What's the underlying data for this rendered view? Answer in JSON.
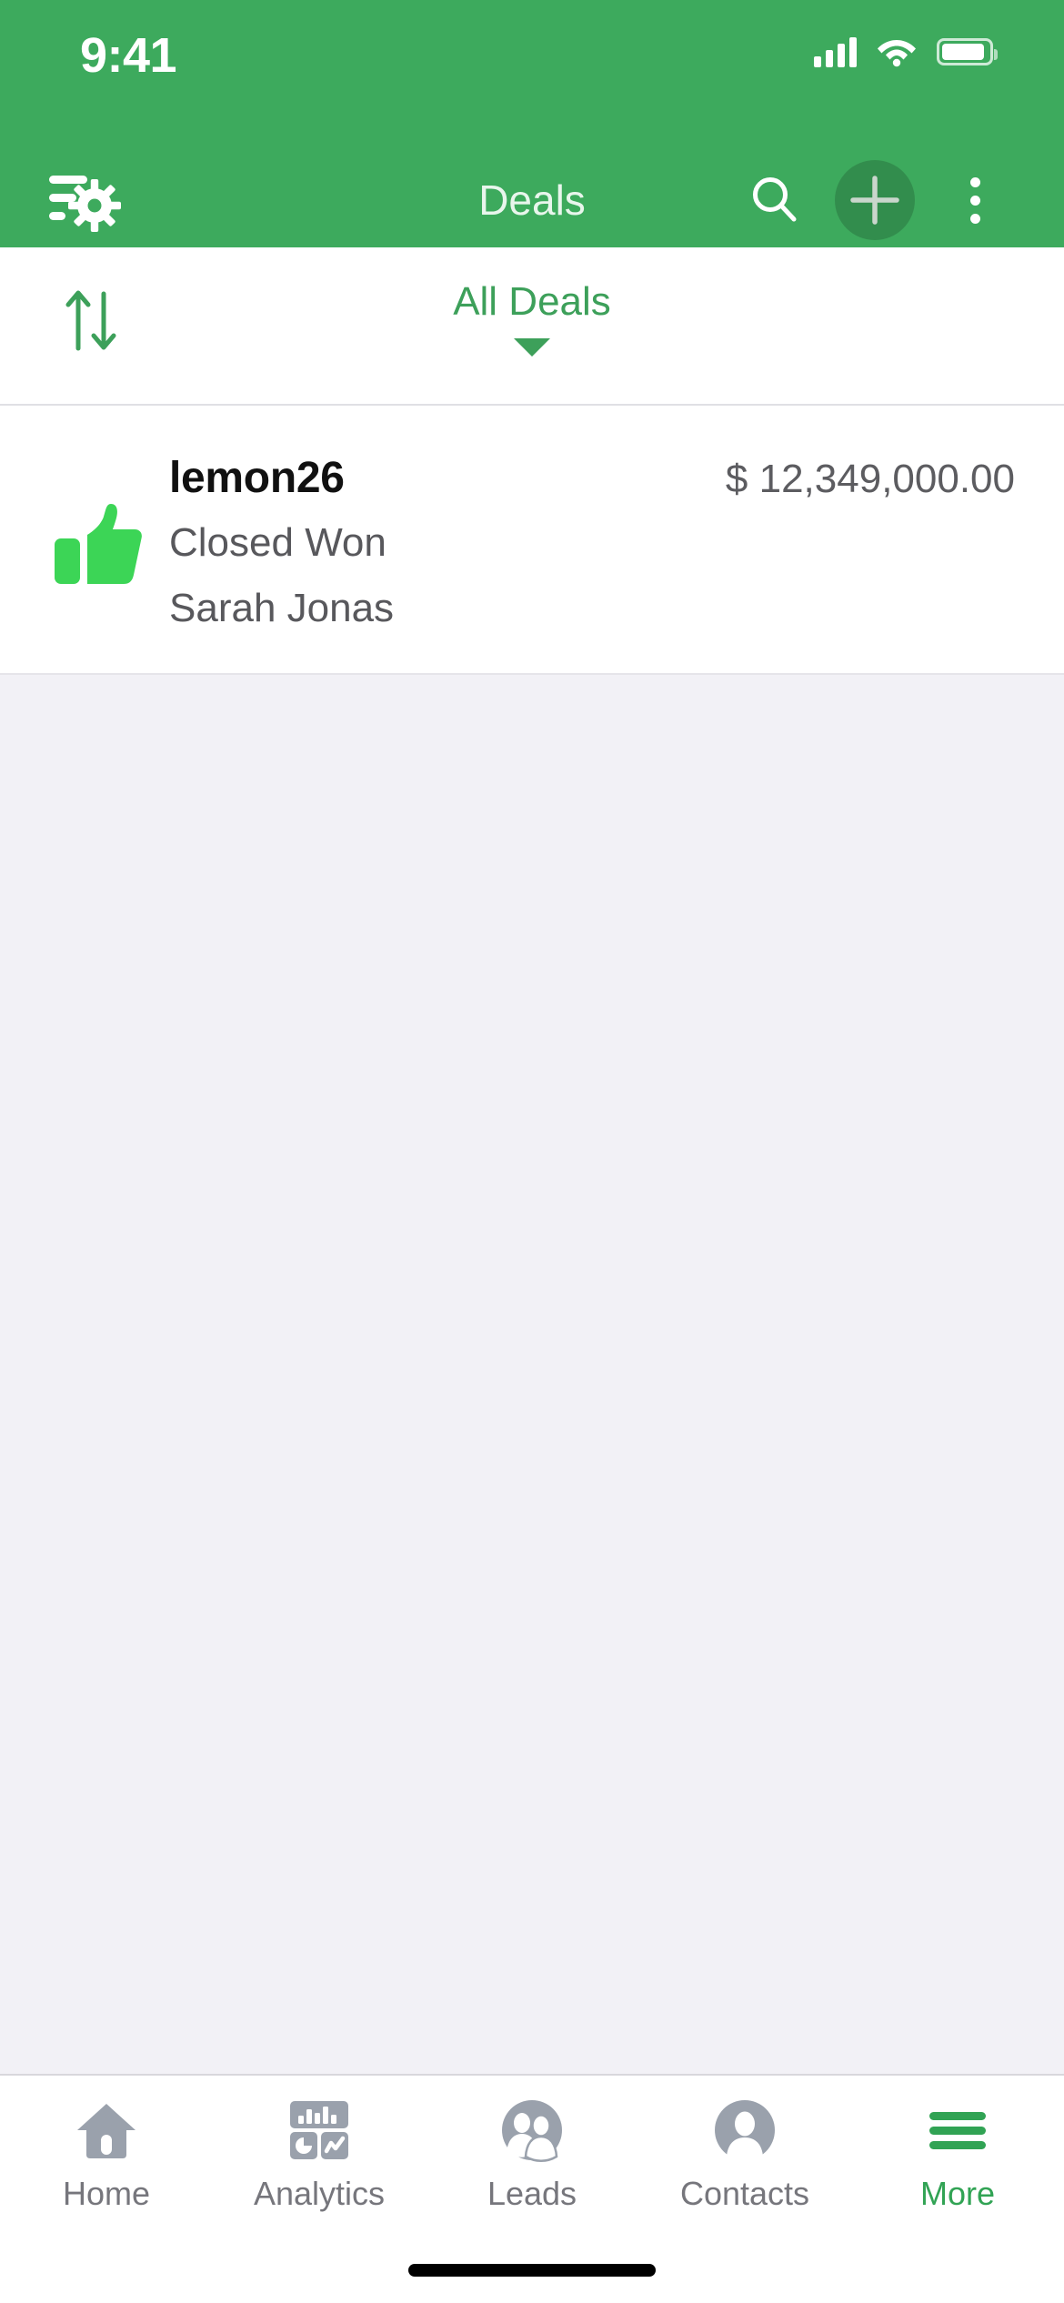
{
  "status_bar": {
    "time": "9:41",
    "cellular_icon": "cellular-signal-icon",
    "wifi_icon": "wifi-icon",
    "battery_icon": "battery-icon"
  },
  "app_bar": {
    "title": "Deals",
    "filter_settings_icon": "filter-settings-icon",
    "search_icon": "search-icon",
    "add_icon": "add-plus-icon",
    "overflow_icon": "overflow-menu-icon",
    "background_color": "#3DAA5D"
  },
  "filter_bar": {
    "sort_icon": "sort-arrows-icon",
    "view_label": "All Deals",
    "caret_icon": "chevron-down-icon",
    "accent_color": "#3DA05A"
  },
  "deals": [
    {
      "status_icon": "thumbs-up-icon",
      "status_icon_color": "#3CD556",
      "name": "lemon26",
      "stage": "Closed Won",
      "owner": "Sarah Jonas",
      "amount": "$ 12,349,000.00"
    }
  ],
  "tab_bar": {
    "items": [
      {
        "label": "Home",
        "icon": "home-icon",
        "active": false
      },
      {
        "label": "Analytics",
        "icon": "analytics-icon",
        "active": false
      },
      {
        "label": "Leads",
        "icon": "leads-icon",
        "active": false
      },
      {
        "label": "Contacts",
        "icon": "contacts-icon",
        "active": false
      },
      {
        "label": "More",
        "icon": "hamburger-menu-icon",
        "active": true
      }
    ],
    "inactive_color": "#9AA1AC",
    "active_color": "#31A354"
  }
}
